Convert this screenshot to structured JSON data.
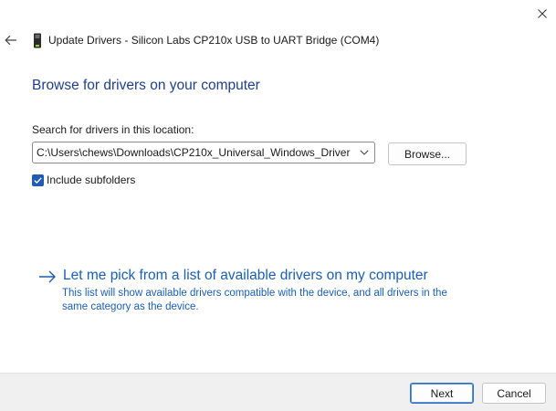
{
  "window": {
    "title": "Update Drivers - Silicon Labs CP210x USB to UART Bridge (COM4)",
    "close_icon": "close-icon",
    "back_icon": "back-arrow-icon",
    "device_icon": "usb-device-icon"
  },
  "main": {
    "heading": "Browse for drivers on your computer",
    "search_label": "Search for drivers in this location:",
    "path_value": "C:\\Users\\chews\\Downloads\\CP210x_Universal_Windows_Driver",
    "browse_label": "Browse...",
    "include_subfolders_label": "Include subfolders",
    "include_subfolders_checked": true,
    "pick_title": "Let me pick from a list of available drivers on my computer",
    "pick_description": "This list will show available drivers compatible with the device, and all drivers in the same category as the device."
  },
  "footer": {
    "next_label": "Next",
    "cancel_label": "Cancel"
  },
  "colors": {
    "heading": "#1e3f8a",
    "link": "#1a5fb4",
    "accent": "#1e5bb4",
    "footer_bg": "#f0f0f0"
  }
}
